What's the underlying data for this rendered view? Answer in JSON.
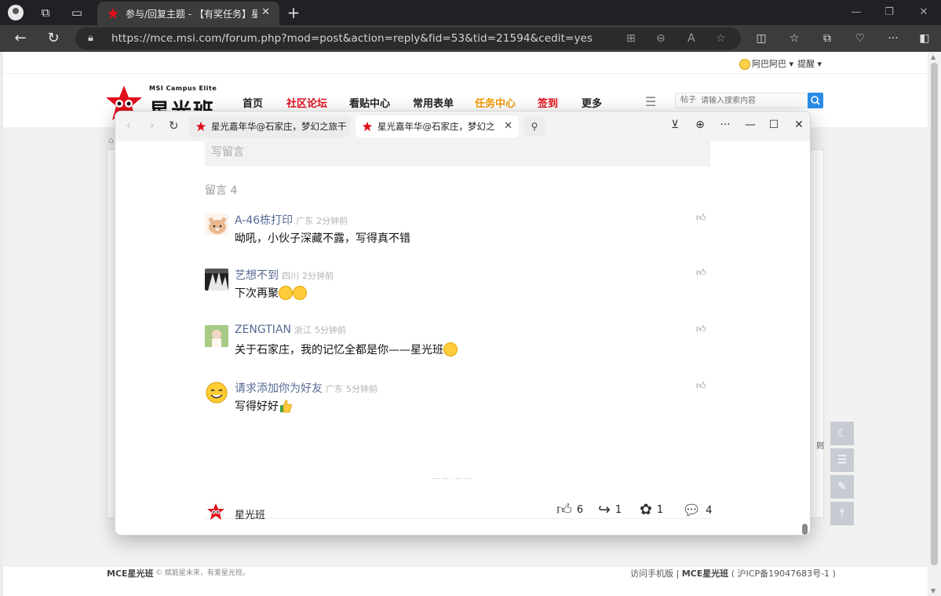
{
  "browser": {
    "tab_title": "参与/回复主题 - 【有奖任务】星",
    "url": "https://mce.msi.com/forum.php?mod=post&action=reply&fid=53&tid=21594&cedit=yes"
  },
  "site": {
    "user": "阿巴阿巴",
    "remind": "提醒",
    "logo_sub": "MSI Campus Elite",
    "logo_main": "星光班",
    "nav": [
      "首页",
      "社区论坛",
      "看贴中心",
      "常用表单",
      "任务中心",
      "签到",
      "更多"
    ],
    "search_kind": "帖子",
    "search_placeholder": "请输入搜索内容",
    "footer_brand": "MCE星光班",
    "footer_slogan": "© 赋能星未来，有爱星光班。",
    "footer_mobile": "访问手机版",
    "footer_right_brand": "MCE星光班",
    "footer_icp": "( 沪ICP备19047683号-1 )",
    "side_partial": "则"
  },
  "popup": {
    "tab1_title": "星光嘉年华@石家庄，梦幻之旅干",
    "tab2_title": "星光嘉年华@石家庄，梦幻之",
    "write_placeholder": "写留言",
    "message_count": "留言 4",
    "comments": [
      {
        "name": "A-46栋打印",
        "location": "广东",
        "time": "2分钟前",
        "text": "呦吼，小伙子深藏不露，写得真不错"
      },
      {
        "name": "艺想不到",
        "location": "四川",
        "time": "2分钟前",
        "text": "下次再聚"
      },
      {
        "name": "ZENGTIAN",
        "location": "浙江",
        "time": "5分钟前",
        "text": "关于石家庄，我的记忆全都是你——星光班"
      },
      {
        "name": "请求添加你为好友",
        "location": "广东",
        "time": "5分钟前",
        "text": "写得好好"
      }
    ],
    "account_name": "星光班",
    "stats": {
      "likes": "6",
      "shares": "1",
      "favorites": "1",
      "comments": "4"
    }
  },
  "colors": {
    "brand_red": "#e0101d",
    "nav_orange": "#f19a00",
    "link_blue": "#576b95",
    "search_blue": "#2b8be6"
  }
}
